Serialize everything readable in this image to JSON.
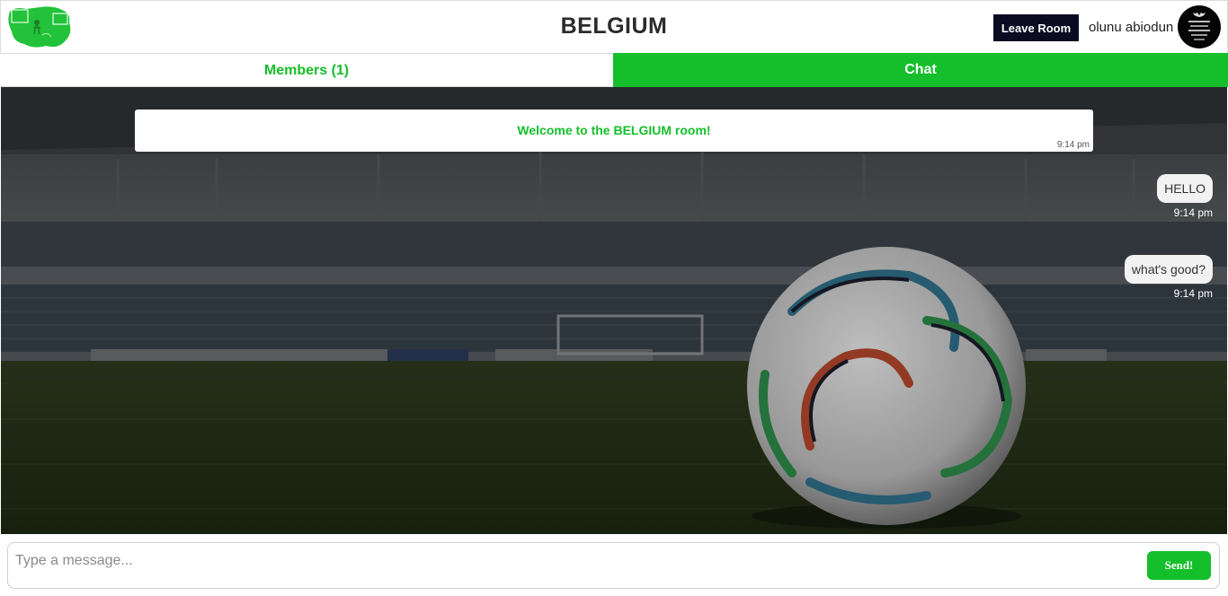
{
  "header": {
    "room_title": "BELGIUM",
    "leave_label": "Leave Room",
    "username": "olunu abiodun"
  },
  "tabs": {
    "members_label": "Members (1)",
    "chat_label": "Chat"
  },
  "chat": {
    "welcome": {
      "text": "Welcome to the BELGIUM room!",
      "time": "9:14 pm"
    },
    "messages": [
      {
        "text": "HELLO",
        "time": "9:14 pm"
      },
      {
        "text": "what's good?",
        "time": "9:14 pm"
      }
    ]
  },
  "composer": {
    "placeholder": "Type a message...",
    "send_label": "Send!"
  },
  "colors": {
    "accent": "#15bf2b",
    "leave_button": "#0b0b22"
  }
}
